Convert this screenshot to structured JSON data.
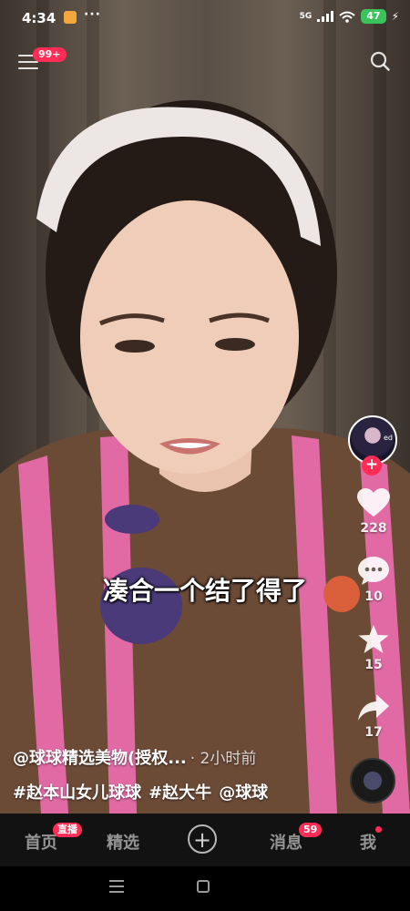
{
  "status_bar": {
    "time": "4:34",
    "more": "···",
    "network": "5G",
    "battery": "47"
  },
  "top_bar": {
    "menu_badge": "99+"
  },
  "video": {
    "subtitle": "凑合一个结了得了"
  },
  "side_rail": {
    "avatar_tag": "ed",
    "follow_symbol": "+",
    "likes": "228",
    "comments": "10",
    "favorites": "15",
    "shares": "17"
  },
  "caption": {
    "author": "@球球精选美物(授权...",
    "time_ago": "· 2小时前",
    "hashtags": [
      "#赵本山女儿球球",
      "#赵大牛",
      "@球球"
    ]
  },
  "bottom_nav": {
    "home_label": "首页",
    "home_badge": "直播",
    "featured_label": "精选",
    "create_symbol": "+",
    "messages_label": "消息",
    "messages_badge": "59",
    "me_label": "我"
  },
  "colors": {
    "accent": "#ff2c55",
    "battery": "#3ac35a",
    "nav_background": "#121212"
  },
  "icons": {
    "menu": "menu-icon",
    "search": "search-icon",
    "like": "heart-icon",
    "comment": "comment-icon",
    "favorite": "star-icon",
    "share": "share-icon"
  }
}
